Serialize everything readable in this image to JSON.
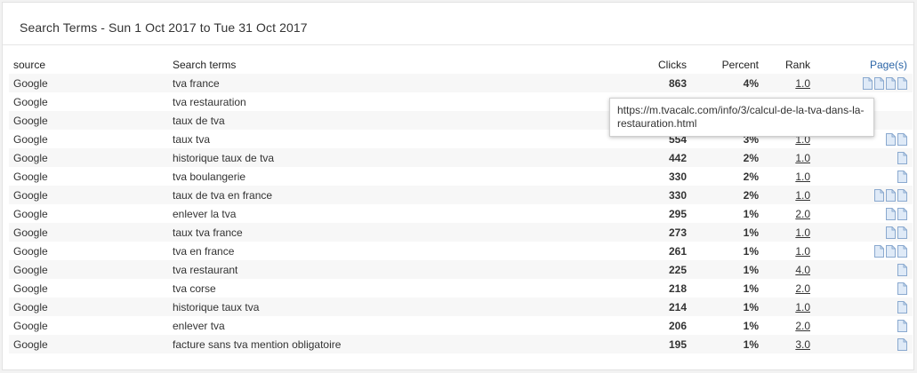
{
  "panel": {
    "title": "Search Terms - Sun 1 Oct 2017 to Tue 31 Oct 2017"
  },
  "table": {
    "headers": {
      "source": "source",
      "term": "Search terms",
      "clicks": "Clicks",
      "percent": "Percent",
      "rank": "Rank",
      "pages": "Page(s)"
    },
    "rows": [
      {
        "source": "Google",
        "term": "tva france",
        "clicks": "863",
        "percent": "4%",
        "rank": "1.0",
        "pages": 4
      },
      {
        "source": "Google",
        "term": "tva restauration",
        "clicks": "",
        "percent": "",
        "rank": "",
        "pages": 0
      },
      {
        "source": "Google",
        "term": "taux de tva",
        "clicks": "",
        "percent": "",
        "rank": "",
        "pages": 0
      },
      {
        "source": "Google",
        "term": "taux tva",
        "clicks": "554",
        "percent": "3%",
        "rank": "1.0",
        "pages": 2
      },
      {
        "source": "Google",
        "term": "historique taux de tva",
        "clicks": "442",
        "percent": "2%",
        "rank": "1.0",
        "pages": 1
      },
      {
        "source": "Google",
        "term": "tva boulangerie",
        "clicks": "330",
        "percent": "2%",
        "rank": "1.0",
        "pages": 1
      },
      {
        "source": "Google",
        "term": "taux de tva en france",
        "clicks": "330",
        "percent": "2%",
        "rank": "1.0",
        "pages": 3
      },
      {
        "source": "Google",
        "term": "enlever la tva",
        "clicks": "295",
        "percent": "1%",
        "rank": "2.0",
        "pages": 2
      },
      {
        "source": "Google",
        "term": "taux tva france",
        "clicks": "273",
        "percent": "1%",
        "rank": "1.0",
        "pages": 2
      },
      {
        "source": "Google",
        "term": "tva en france",
        "clicks": "261",
        "percent": "1%",
        "rank": "1.0",
        "pages": 3
      },
      {
        "source": "Google",
        "term": "tva restaurant",
        "clicks": "225",
        "percent": "1%",
        "rank": "4.0",
        "pages": 1
      },
      {
        "source": "Google",
        "term": "tva corse",
        "clicks": "218",
        "percent": "1%",
        "rank": "2.0",
        "pages": 1
      },
      {
        "source": "Google",
        "term": "historique taux tva",
        "clicks": "214",
        "percent": "1%",
        "rank": "1.0",
        "pages": 1
      },
      {
        "source": "Google",
        "term": "enlever tva",
        "clicks": "206",
        "percent": "1%",
        "rank": "2.0",
        "pages": 1
      },
      {
        "source": "Google",
        "term": "facture sans tva mention obligatoire",
        "clicks": "195",
        "percent": "1%",
        "rank": "3.0",
        "pages": 1
      }
    ]
  },
  "tooltip": {
    "text": "https://m.tvacalc.com/info/3/calcul-de-la-tva-dans-la-restauration.html"
  },
  "icons": {
    "page": "page-icon"
  },
  "colors": {
    "pages_header": "#2a64a6",
    "page_icon_fill": "#dfeaf7",
    "page_icon_stroke": "#8aa9cf"
  }
}
